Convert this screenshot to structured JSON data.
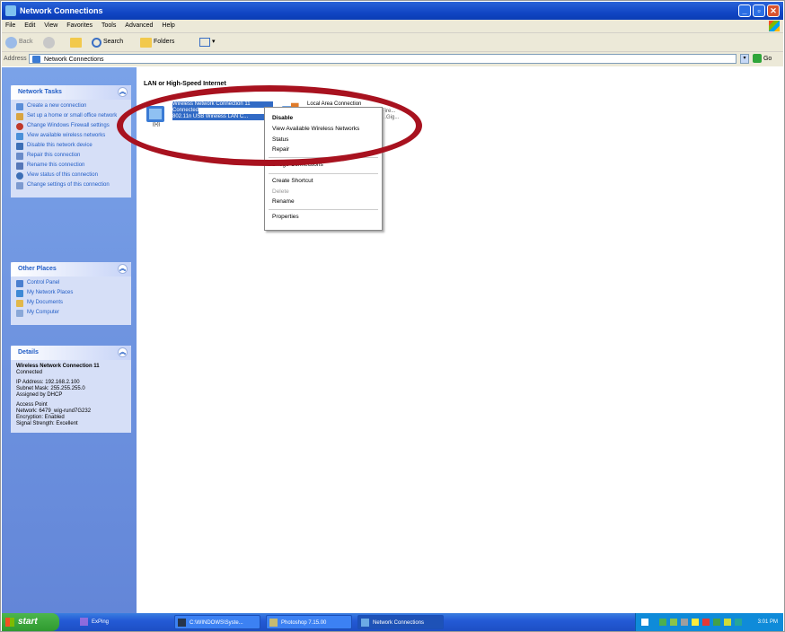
{
  "window": {
    "title": "Network Connections"
  },
  "menu": [
    "File",
    "Edit",
    "View",
    "Favorites",
    "Tools",
    "Advanced",
    "Help"
  ],
  "toolbar": {
    "back": "Back",
    "search": "Search",
    "folders": "Folders"
  },
  "address": {
    "label": "Address",
    "value": "Network Connections",
    "go": "Go"
  },
  "network_tasks": {
    "title": "Network Tasks",
    "items": [
      "Create a new connection",
      "Set up a home or small office network",
      "Change Windows Firewall settings",
      "View available wireless networks",
      "Disable this network device",
      "Repair this connection",
      "Rename this connection",
      "View status of this connection",
      "Change settings of this connection"
    ]
  },
  "other_places": {
    "title": "Other Places",
    "items": [
      "Control Panel",
      "My Network Places",
      "My Documents",
      "My Computer"
    ]
  },
  "details": {
    "title": "Details",
    "name": "Wireless Network Connection 11",
    "status": "Connected",
    "ip": "IP Address: 192.168.2.100",
    "mask": "Subnet Mask: 255.255.255.0",
    "assigned": "Assigned by DHCP",
    "access_point": "Access Point",
    "network": "Network: 6479_wig-rund7G232",
    "encryption": "Encryption: Enabled",
    "signal": "Signal Strength: Excellent"
  },
  "content": {
    "group": "LAN or High-Speed Internet",
    "wireless": {
      "name": "Wireless Network Connection 11",
      "status": "Connected",
      "device": "802.11n USB Wireless LAN C..."
    },
    "lan": {
      "name": "Local Area Connection",
      "line2": "Fire...",
      "line3": "...Gig..."
    }
  },
  "context_menu": {
    "disable": "Disable",
    "view_networks": "View Available Wireless Networks",
    "status": "Status",
    "repair": "Repair",
    "bridge": "Bridge Connections",
    "shortcut": "Create Shortcut",
    "delete": "Delete",
    "rename": "Rename",
    "properties": "Properties"
  },
  "taskbar": {
    "start": "start",
    "tasks": [
      "ExPing",
      "C:\\WINDOWS\\Syste...",
      "Photoshop 7.15.00",
      "Network Connections"
    ],
    "clock": "3:01 PM"
  },
  "colors": {
    "highlight": "#a8121f",
    "xp_blue": "#245bd6",
    "selection": "#316ac5"
  }
}
